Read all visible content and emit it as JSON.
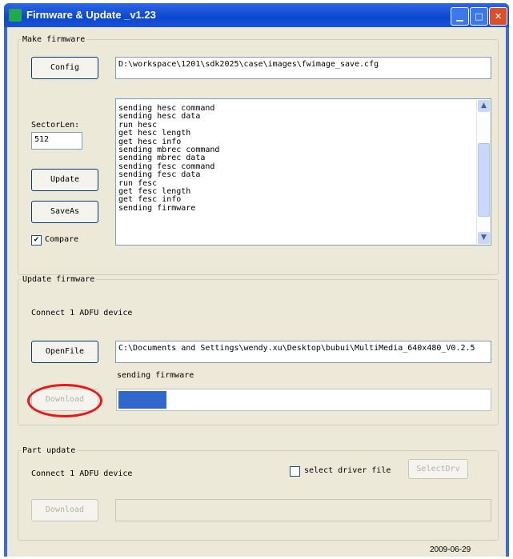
{
  "window": {
    "title": "Firmware & Update _v1.23"
  },
  "make_firmware": {
    "legend": "Make firmware",
    "config_label": "Config",
    "config_path": "D:\\workspace\\1201\\sdk2025\\case\\images\\fwimage_save.cfg",
    "sectorlen_label": "SectorLen:",
    "sectorlen_value": "512",
    "update_label": "Update",
    "saveas_label": "SaveAs",
    "compare_label": "Compare",
    "compare_checked": "✔",
    "log_lines": [
      "sending hesc command",
      "sending hesc data",
      "run hesc",
      "get hesc length",
      "get hesc info",
      "sending mbrec command",
      "sending mbrec data",
      "sending fesc command",
      "sending fesc data",
      "run fesc",
      "get fesc length",
      "get fesc info",
      "sending firmware"
    ]
  },
  "update_firmware": {
    "legend": "Update firmware",
    "device_status": "Connect 1 ADFU device",
    "openfile_label": "OpenFile",
    "file_path": "C:\\Documents and Settings\\wendy.xu\\Desktop\\bubui\\MultiMedia_640x480_V0.2.5",
    "progress_status": "sending firmware",
    "download_label": "Download",
    "progress_fraction": 0.13
  },
  "part_update": {
    "legend": "Part update",
    "device_status": "Connect 1 ADFU device",
    "select_driver_label": "select driver file",
    "selectdrv_label": "SelectDrv",
    "download_label": "Download"
  },
  "footer": {
    "date": "2009-06-29"
  },
  "colors": {
    "title_bar": "#0a47d0",
    "client_bg": "#ece9d8",
    "highlight_circle": "#e81818",
    "progress_fill": "#3068cc"
  },
  "icons": {
    "app": "app-icon",
    "minimize": "minimize-icon",
    "maximize": "maximize-icon",
    "close": "close-icon",
    "scroll_up": "chevron-up-icon",
    "scroll_down": "chevron-down-icon"
  }
}
